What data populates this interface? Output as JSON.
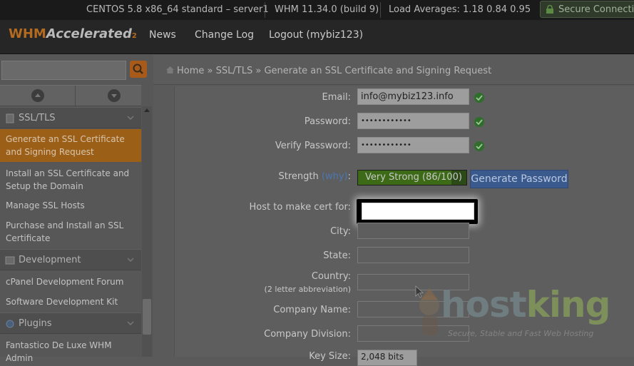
{
  "topbar": {
    "server": "CENTOS 5.8 x86_64 standard – server1",
    "whm_version": "WHM 11.34.0 (build 9)",
    "load": "Load Averages: 1.18 0.84 0.95",
    "secure": "Secure Connection"
  },
  "header": {
    "logo_main": "WHM",
    "logo_accent": "Accelerated",
    "logo_sup": "2",
    "nav": [
      "News",
      "Change Log",
      "Logout (mybiz123)"
    ]
  },
  "sidebar": {
    "groups": [
      {
        "label": "SSL/TLS",
        "icon": "ssl-icon"
      },
      {
        "label": "Development",
        "icon": "development-icon"
      },
      {
        "label": "Plugins",
        "icon": "plugins-icon"
      }
    ],
    "ssl_items": [
      "Generate an SSL Certificate and Signing Request",
      "Install an SSL Certificate and Setup the Domain",
      "Manage SSL Hosts",
      "Purchase and Install an SSL Certificate"
    ],
    "dev_items": [
      "cPanel Development Forum",
      "Software Development Kit"
    ],
    "plugin_items": [
      "Fantastico De Luxe WHM Admin"
    ]
  },
  "breadcrumb": {
    "home": "Home",
    "sep": "»",
    "section": "SSL/TLS",
    "current": "Generate an SSL Certificate and Signing Request"
  },
  "form": {
    "email_label": "Email:",
    "email_value": "info@mybiz123.info",
    "password_label": "Password:",
    "password_value": "••••••••••••",
    "verify_label": "Verify Password:",
    "verify_value": "••••••••••••",
    "strength_label": "Strength",
    "strength_why": "(why)",
    "strength_colon": ":",
    "strength_text": "Very Strong (86/100)",
    "strength_percent": 86,
    "generate_button": "Generate Password",
    "host_label": "Host to make cert for:",
    "host_value": "",
    "city_label": "City:",
    "state_label": "State:",
    "country_label": "Country:",
    "country_sub": "(2 letter abbreviation)",
    "company_label": "Company Name:",
    "division_label": "Company Division:",
    "keysize_label": "Key Size:",
    "keysize_value": "2,048 bits"
  },
  "watermark": {
    "brand_a": "host",
    "brand_b": "king",
    "tagline": "Secure, Stable and Fast Web Hosting"
  },
  "colors": {
    "accent": "#9c5f17",
    "check": "#2f6e2a",
    "button": "#3a5a8e"
  }
}
